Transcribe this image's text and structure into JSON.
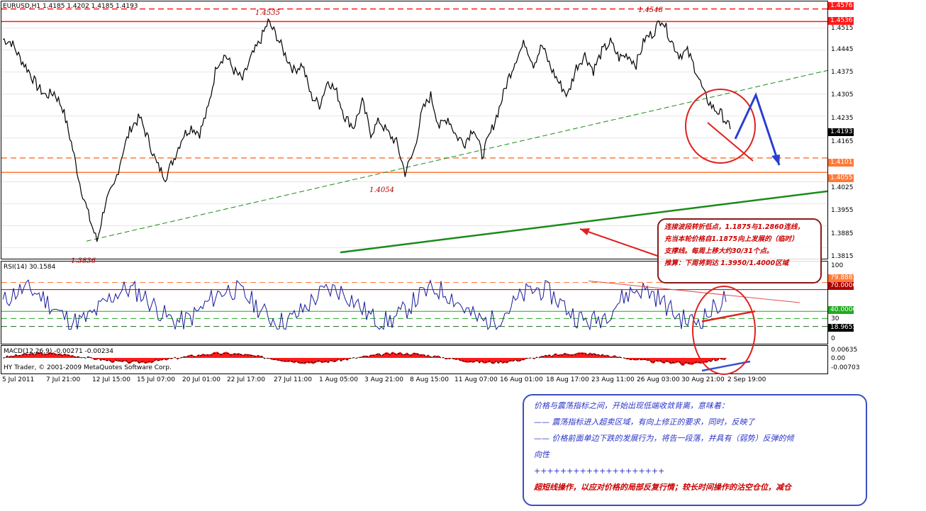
{
  "chart_header": {
    "symbol_line": "EURUSD,H1  1.4185 1.4202 1.4185 1.4193"
  },
  "price_axis": {
    "labels": [
      "1.4515",
      "1.4445",
      "1.4375",
      "1.4305",
      "1.4235",
      "1.4165",
      "1.4025",
      "1.3955",
      "1.3885",
      "1.3815"
    ],
    "tags": [
      {
        "text": "1.4576",
        "bg": "#ff1a1a",
        "fg": "#ffffff"
      },
      {
        "text": "1.4536",
        "bg": "#ff1a1a",
        "fg": "#ffffff"
      },
      {
        "text": "1.4193",
        "bg": "#000000",
        "fg": "#ffffff"
      },
      {
        "text": "1.4101",
        "bg": "#ff7a3a",
        "fg": "#ffffff"
      },
      {
        "text": "1.4055",
        "bg": "#ff7a3a",
        "fg": "#ffffff"
      }
    ]
  },
  "peaks": {
    "p1": "1.4535",
    "p2": "1.4548",
    "t1": "1.4054",
    "t2": "1.3836"
  },
  "rsi": {
    "title": "RSI(14) 30.1584",
    "axis": [
      "100",
      "30",
      "0"
    ],
    "tags": [
      {
        "text": "79.8883",
        "bg": "#ff7a3a",
        "fg": "#ffffff"
      },
      {
        "text": "70.0000",
        "bg": "#b00000",
        "fg": "#ffffff"
      },
      {
        "text": "40.0000",
        "bg": "#22aa22",
        "fg": "#ffffff"
      },
      {
        "text": "18.9655",
        "bg": "#000000",
        "fg": "#ffffff"
      }
    ]
  },
  "macd": {
    "title": "MACD(12,26,9) -0.00271 -0.00234",
    "axis": [
      "0.00635",
      "0.00",
      "-0.00703"
    ],
    "copyright": "HY Trader, © 2001-2009 MetaQuotes Software Corp."
  },
  "time_axis": [
    "5 Jul 2011",
    "7 Jul 21:00",
    "12 Jul 15:00",
    "15 Jul 07:00",
    "20 Jul 01:00",
    "22 Jul 17:00",
    "27 Jul 11:00",
    "1 Aug 05:00",
    "3 Aug 21:00",
    "8 Aug 15:00",
    "11 Aug 07:00",
    "16 Aug 01:00",
    "18 Aug 17:00",
    "23 Aug 11:00",
    "26 Aug 03:00",
    "30 Aug 21:00",
    "2 Sep 19:00"
  ],
  "note_support": [
    "连接波段转折低点，1.1875与1.2860连线，",
    "充当本轮价格自1.1875向上发展的（临时）",
    "支撑线。每周上移大约30/31个点。",
    "推算：下周将到达 1.3950/1.4000区域"
  ],
  "note_divergence": [
    {
      "text": "价格与震荡指标之间，开始出现低端收敛背离，意味着：",
      "style": "blue"
    },
    {
      "text": "—— 震荡指标进入超卖区域，有向上修正的要求，同时，反映了",
      "style": "blue"
    },
    {
      "text": "—— 价格前面单边下跌的发展行为，将告一段落，并具有（弱势）反弹的倾",
      "style": "blue"
    },
    {
      "text": "向性",
      "style": "blue"
    },
    {
      "text": "++++++++++++++++++++",
      "style": "blue"
    },
    {
      "text": "超短线操作，以应对价格的局部反复行情；较长时间操作的沽空仓位，减仓",
      "style": "red"
    }
  ],
  "chart_data": {
    "type": "line",
    "title": "EURUSD,H1",
    "xlabel": "",
    "ylabel": "",
    "ylim": [
      1.378,
      1.46
    ],
    "x_ticks": [
      "5 Jul 2011",
      "7 Jul 21:00",
      "12 Jul 15:00",
      "15 Jul 07:00",
      "20 Jul 01:00",
      "22 Jul 17:00",
      "27 Jul 11:00",
      "1 Aug 05:00",
      "3 Aug 21:00",
      "8 Aug 15:00",
      "11 Aug 07:00",
      "16 Aug 01:00",
      "18 Aug 17:00",
      "23 Aug 11:00",
      "26 Aug 03:00",
      "30 Aug 21:00",
      "2 Sep 19:00"
    ],
    "series": [
      {
        "name": "EURUSD,H1",
        "color": "#000000",
        "values": [
          1.448,
          1.447,
          1.442,
          1.438,
          1.433,
          1.43,
          1.431,
          1.426,
          1.415,
          1.402,
          1.392,
          1.3836,
          1.396,
          1.401,
          1.412,
          1.42,
          1.423,
          1.416,
          1.408,
          1.404,
          1.41,
          1.417,
          1.42,
          1.418,
          1.426,
          1.44,
          1.443,
          1.438,
          1.435,
          1.442,
          1.447,
          1.4535,
          1.449,
          1.443,
          1.438,
          1.44,
          1.43,
          1.427,
          1.435,
          1.431,
          1.423,
          1.42,
          1.428,
          1.418,
          1.422,
          1.418,
          1.415,
          1.4054,
          1.412,
          1.425,
          1.43,
          1.42,
          1.423,
          1.417,
          1.415,
          1.42,
          1.411,
          1.418,
          1.426,
          1.435,
          1.442,
          1.447,
          1.44,
          1.446,
          1.439,
          1.434,
          1.43,
          1.439,
          1.443,
          1.438,
          1.444,
          1.447,
          1.442,
          1.443,
          1.44,
          1.448,
          1.45,
          1.4548,
          1.448,
          1.443,
          1.444,
          1.438,
          1.43,
          1.426,
          1.424,
          1.4193
        ]
      }
    ],
    "horizontal_levels": [
      {
        "value": 1.4576,
        "color": "#ff1a1a",
        "style": "dashed"
      },
      {
        "value": 1.4536,
        "color": "#ff1a1a",
        "style": "solid"
      },
      {
        "value": 1.4101,
        "color": "#ff7a3a",
        "style": "dashed"
      },
      {
        "value": 1.4055,
        "color": "#ff7a3a",
        "style": "solid"
      }
    ],
    "indicators": {
      "rsi_period": 14,
      "rsi_last": 30.1584,
      "rsi_levels": [
        79.8883,
        70.0,
        40.0,
        18.9655
      ],
      "macd_params": [
        12,
        26,
        9
      ],
      "macd_last": [
        -0.00271,
        -0.00234
      ],
      "macd_range": [
        -0.00703,
        0.00635
      ]
    }
  }
}
